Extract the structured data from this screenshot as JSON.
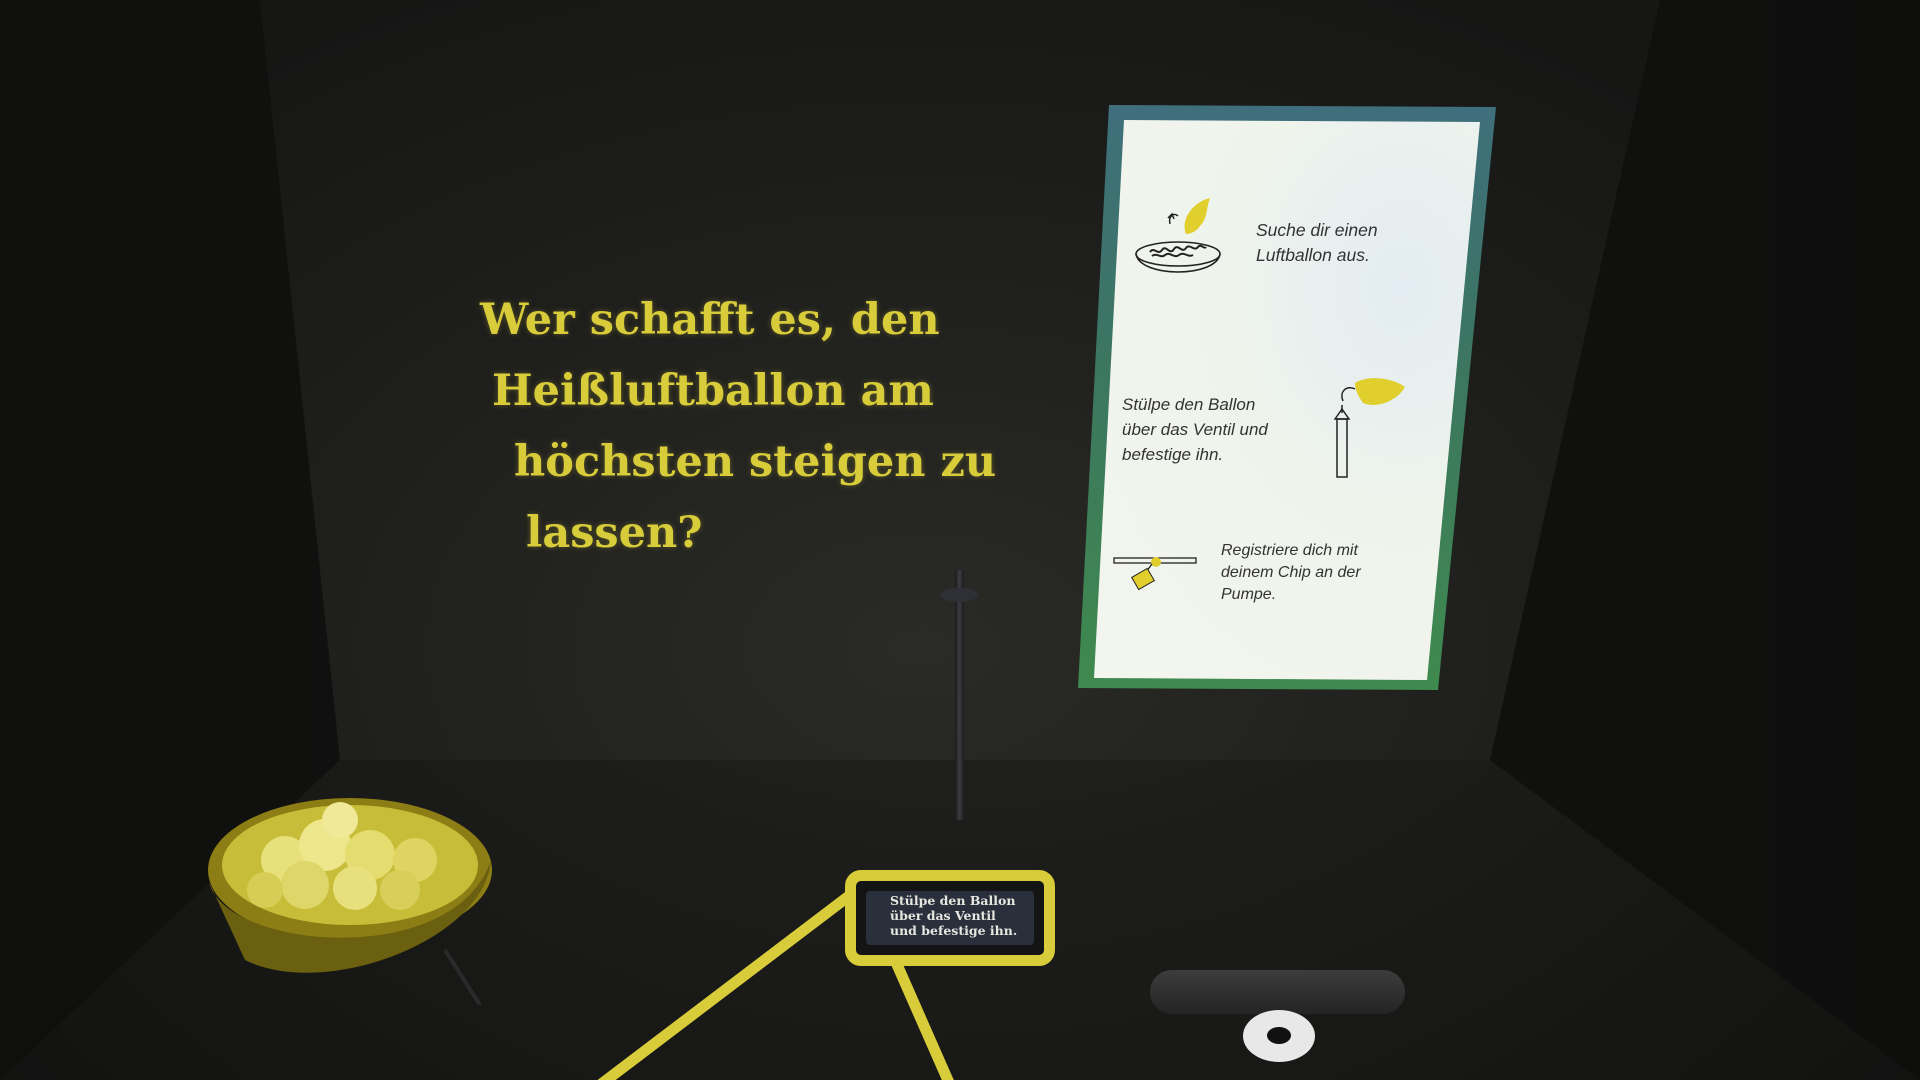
{
  "exhibit": {
    "headline": {
      "line1": "Wer schafft es, den",
      "line2": "Heißluftballon am",
      "line3": "höchsten steigen zu",
      "line4": "lassen?"
    },
    "screen": {
      "steps": [
        {
          "text": "Suche dir einen\nLuftballon aus.",
          "icon": "balloon-bowl-icon"
        },
        {
          "text": "Stülpe den Ballon\nüber das Ventil und\nbefestige ihn.",
          "icon": "valve-balloon-icon"
        },
        {
          "text": "Registriere dich mit\ndeinem Chip an der\nPumpe.",
          "icon": "chip-pump-icon"
        }
      ]
    },
    "floor_sign": {
      "text": "Stülpe den Ballon\nüber das Ventil\nund befestige ihn."
    }
  },
  "colors": {
    "accent": "#d8cc3a",
    "wall": "#1e1e1c",
    "screen_frame": "#3f8a4e",
    "sign_panel": "#2a2f3c"
  }
}
